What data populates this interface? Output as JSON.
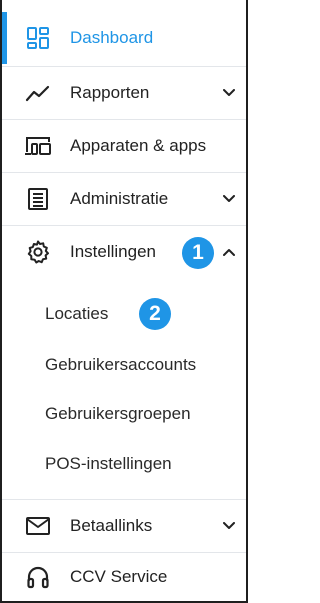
{
  "nav": {
    "dashboard": {
      "label": "Dashboard",
      "icon": "dashboard-icon",
      "active": true
    },
    "rapporten": {
      "label": "Rapporten",
      "icon": "chart-line-icon"
    },
    "apparaten": {
      "label": "Apparaten & apps",
      "icon": "devices-icon"
    },
    "administratie": {
      "label": "Administratie",
      "icon": "list-document-icon"
    },
    "instellingen": {
      "label": "Instellingen",
      "icon": "gear-icon",
      "expanded": true
    },
    "betaallinks": {
      "label": "Betaallinks",
      "icon": "envelope-icon"
    },
    "ccv_service": {
      "label": "CCV Service",
      "icon": "headset-icon"
    }
  },
  "submenu": {
    "locaties": "Locaties",
    "gebruikersaccounts": "Gebruikersaccounts",
    "gebruikersgroepen": "Gebruikersgroepen",
    "pos_instellingen": "POS-instellingen"
  },
  "badges": {
    "one": "1",
    "two": "2"
  },
  "colors": {
    "accent": "#1f95e6",
    "divider": "#e3e6ea",
    "text": "#222222"
  }
}
